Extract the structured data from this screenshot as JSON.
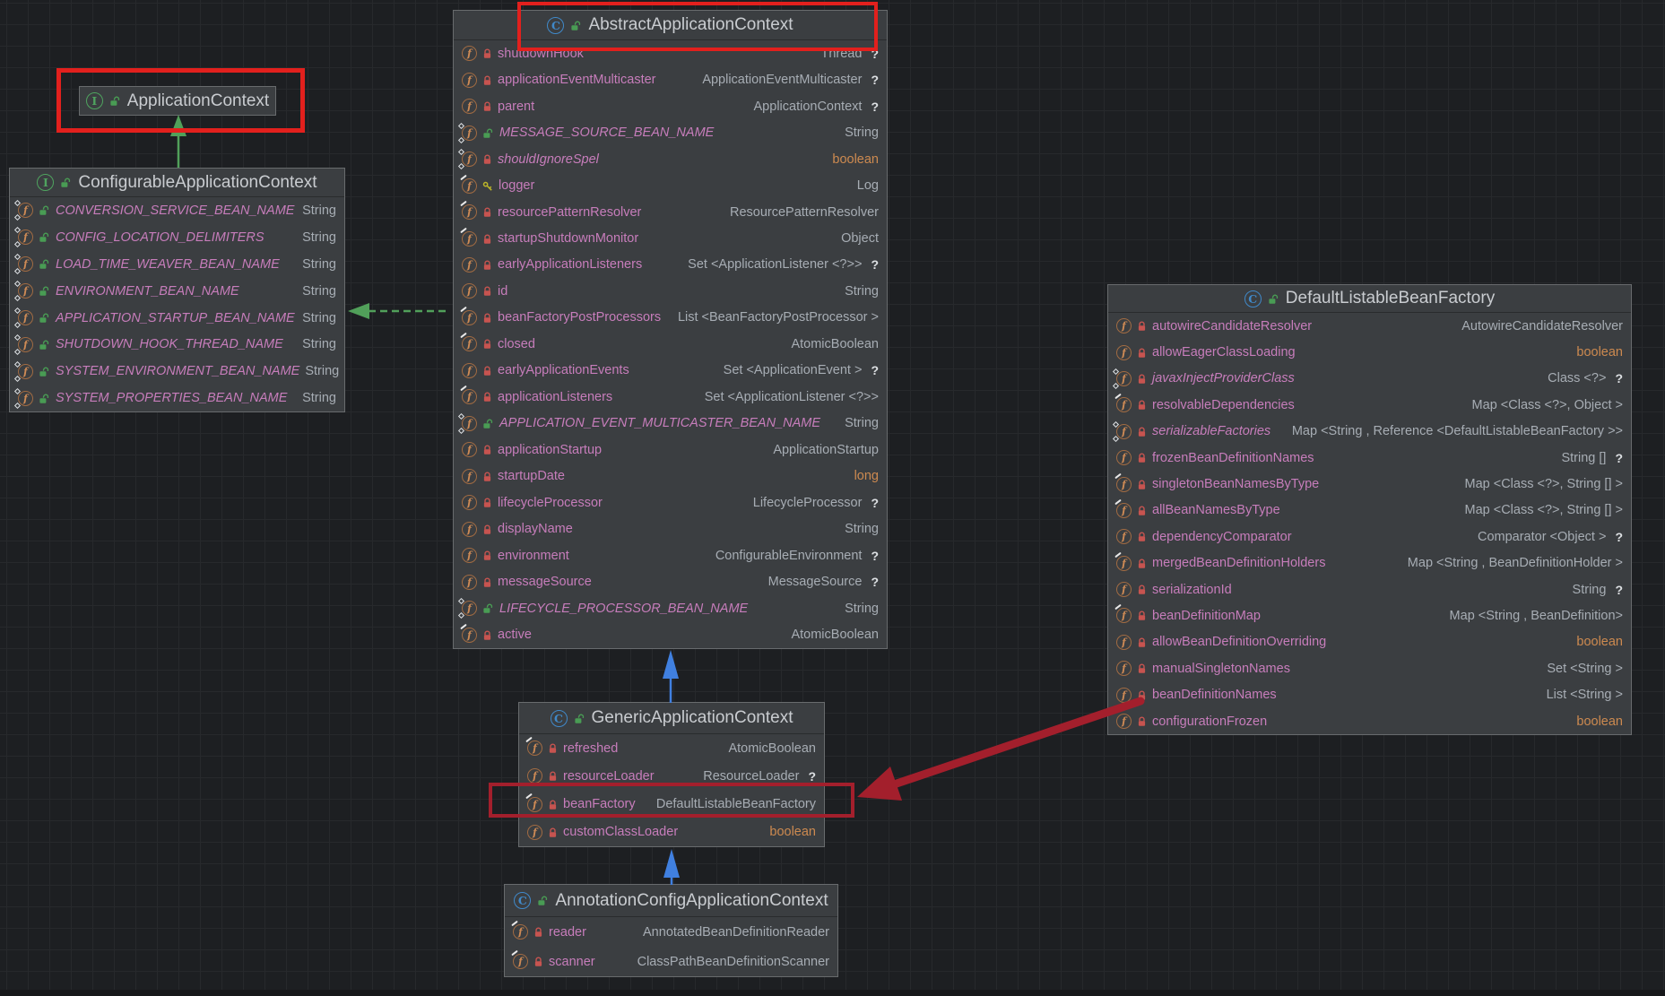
{
  "palette": {
    "canvas_bg": "#1d1f22",
    "grid_line": "#27292c",
    "node_bg": "#3b3e41",
    "node_border": "#686b6d",
    "title_text": "#c9ccd0",
    "field_name": "#c77dbb",
    "type_text": "#a7adb4",
    "primitive_type": "#cd8a50",
    "class_icon_blue": "#4089c9",
    "interface_icon_green": "#4fa45f",
    "field_icon_orange": "#a16b42",
    "private_lock_red": "#c75450",
    "public_lock_green": "#499c54",
    "protected_key_yellow": "#bbb529",
    "arrow_green": "#51a05a",
    "arrow_blue": "#4080e0",
    "annotation_red": "#e2201d",
    "annotation_crimson": "#a31f2c"
  },
  "classes": [
    {
      "id": "applicationContext",
      "kind": "interface",
      "title": "ApplicationContext",
      "fields": []
    },
    {
      "id": "configurableApplicationContext",
      "kind": "interface",
      "title": "ConfigurableApplicationContext",
      "fields": [
        {
          "name": "CONVERSION_SERVICE_BEAN_NAME",
          "vis": "public",
          "mod": "static",
          "type": "String",
          "opt": false,
          "prim": false
        },
        {
          "name": "CONFIG_LOCATION_DELIMITERS",
          "vis": "public",
          "mod": "static",
          "type": "String",
          "opt": false,
          "prim": false
        },
        {
          "name": "LOAD_TIME_WEAVER_BEAN_NAME",
          "vis": "public",
          "mod": "static",
          "type": "String",
          "opt": false,
          "prim": false
        },
        {
          "name": "ENVIRONMENT_BEAN_NAME",
          "vis": "public",
          "mod": "static",
          "type": "String",
          "opt": false,
          "prim": false
        },
        {
          "name": "APPLICATION_STARTUP_BEAN_NAME",
          "vis": "public",
          "mod": "static",
          "type": "String",
          "opt": false,
          "prim": false
        },
        {
          "name": "SHUTDOWN_HOOK_THREAD_NAME",
          "vis": "public",
          "mod": "static",
          "type": "String",
          "opt": false,
          "prim": false
        },
        {
          "name": "SYSTEM_ENVIRONMENT_BEAN_NAME",
          "vis": "public",
          "mod": "static",
          "type": "String",
          "opt": false,
          "prim": false
        },
        {
          "name": "SYSTEM_PROPERTIES_BEAN_NAME",
          "vis": "public",
          "mod": "static",
          "type": "String",
          "opt": false,
          "prim": false
        }
      ]
    },
    {
      "id": "abstractApplicationContext",
      "kind": "class",
      "title": "AbstractApplicationContext",
      "fields": [
        {
          "name": "shutdownHook",
          "vis": "private",
          "mod": "",
          "type": "Thread",
          "opt": true,
          "prim": false
        },
        {
          "name": "applicationEventMulticaster",
          "vis": "private",
          "mod": "",
          "type": "ApplicationEventMulticaster",
          "opt": true,
          "prim": false
        },
        {
          "name": "parent",
          "vis": "private",
          "mod": "",
          "type": "ApplicationContext",
          "opt": true,
          "prim": false
        },
        {
          "name": "MESSAGE_SOURCE_BEAN_NAME",
          "vis": "public",
          "mod": "static",
          "type": "String",
          "opt": false,
          "prim": false
        },
        {
          "name": "shouldIgnoreSpel",
          "vis": "private",
          "mod": "static",
          "type": "boolean",
          "opt": false,
          "prim": true
        },
        {
          "name": "logger",
          "vis": "protected",
          "mod": "final",
          "type": "Log",
          "opt": false,
          "prim": false
        },
        {
          "name": "resourcePatternResolver",
          "vis": "private",
          "mod": "final",
          "type": "ResourcePatternResolver",
          "opt": false,
          "prim": false
        },
        {
          "name": "startupShutdownMonitor",
          "vis": "private",
          "mod": "final",
          "type": "Object",
          "opt": false,
          "prim": false
        },
        {
          "name": "earlyApplicationListeners",
          "vis": "private",
          "mod": "",
          "type": "Set <ApplicationListener <?>>",
          "opt": true,
          "prim": false
        },
        {
          "name": "id",
          "vis": "private",
          "mod": "",
          "type": "String",
          "opt": false,
          "prim": false
        },
        {
          "name": "beanFactoryPostProcessors",
          "vis": "private",
          "mod": "final",
          "type": "List <BeanFactoryPostProcessor >",
          "opt": false,
          "prim": false
        },
        {
          "name": "closed",
          "vis": "private",
          "mod": "final",
          "type": "AtomicBoolean",
          "opt": false,
          "prim": false
        },
        {
          "name": "earlyApplicationEvents",
          "vis": "private",
          "mod": "",
          "type": "Set <ApplicationEvent >",
          "opt": true,
          "prim": false
        },
        {
          "name": "applicationListeners",
          "vis": "private",
          "mod": "final",
          "type": "Set <ApplicationListener <?>>",
          "opt": false,
          "prim": false
        },
        {
          "name": "APPLICATION_EVENT_MULTICASTER_BEAN_NAME",
          "vis": "public",
          "mod": "static",
          "type": "String",
          "opt": false,
          "prim": false
        },
        {
          "name": "applicationStartup",
          "vis": "private",
          "mod": "",
          "type": "ApplicationStartup",
          "opt": false,
          "prim": false
        },
        {
          "name": "startupDate",
          "vis": "private",
          "mod": "",
          "type": "long",
          "opt": false,
          "prim": true
        },
        {
          "name": "lifecycleProcessor",
          "vis": "private",
          "mod": "",
          "type": "LifecycleProcessor",
          "opt": true,
          "prim": false
        },
        {
          "name": "displayName",
          "vis": "private",
          "mod": "",
          "type": "String",
          "opt": false,
          "prim": false
        },
        {
          "name": "environment",
          "vis": "private",
          "mod": "",
          "type": "ConfigurableEnvironment",
          "opt": true,
          "prim": false
        },
        {
          "name": "messageSource",
          "vis": "private",
          "mod": "",
          "type": "MessageSource",
          "opt": true,
          "prim": false
        },
        {
          "name": "LIFECYCLE_PROCESSOR_BEAN_NAME",
          "vis": "public",
          "mod": "static",
          "type": "String",
          "opt": false,
          "prim": false
        },
        {
          "name": "active",
          "vis": "private",
          "mod": "final",
          "type": "AtomicBoolean",
          "opt": false,
          "prim": false
        }
      ]
    },
    {
      "id": "genericApplicationContext",
      "kind": "class",
      "title": "GenericApplicationContext",
      "fields": [
        {
          "name": "refreshed",
          "vis": "private",
          "mod": "final",
          "type": "AtomicBoolean",
          "opt": false,
          "prim": false
        },
        {
          "name": "resourceLoader",
          "vis": "private",
          "mod": "",
          "type": "ResourceLoader",
          "opt": true,
          "prim": false
        },
        {
          "name": "beanFactory",
          "vis": "private",
          "mod": "final",
          "type": "DefaultListableBeanFactory",
          "opt": false,
          "prim": false
        },
        {
          "name": "customClassLoader",
          "vis": "private",
          "mod": "",
          "type": "boolean",
          "opt": false,
          "prim": true
        }
      ]
    },
    {
      "id": "annotationConfigApplicationContext",
      "kind": "class",
      "title": "AnnotationConfigApplicationContext",
      "fields": [
        {
          "name": "reader",
          "vis": "private",
          "mod": "final",
          "type": "AnnotatedBeanDefinitionReader",
          "opt": false,
          "prim": false
        },
        {
          "name": "scanner",
          "vis": "private",
          "mod": "final",
          "type": "ClassPathBeanDefinitionScanner",
          "opt": false,
          "prim": false
        }
      ]
    },
    {
      "id": "defaultListableBeanFactory",
      "kind": "class",
      "title": "DefaultListableBeanFactory",
      "fields": [
        {
          "name": "autowireCandidateResolver",
          "vis": "private",
          "mod": "",
          "type": "AutowireCandidateResolver",
          "opt": false,
          "prim": false
        },
        {
          "name": "allowEagerClassLoading",
          "vis": "private",
          "mod": "",
          "type": "boolean",
          "opt": false,
          "prim": true
        },
        {
          "name": "javaxInjectProviderClass",
          "vis": "private",
          "mod": "static",
          "type": "Class <?>",
          "opt": true,
          "prim": false
        },
        {
          "name": "resolvableDependencies",
          "vis": "private",
          "mod": "final",
          "type": "Map <Class <?>, Object >",
          "opt": false,
          "prim": false
        },
        {
          "name": "serializableFactories",
          "vis": "private",
          "mod": "static",
          "type": "Map <String , Reference <DefaultListableBeanFactory >>",
          "opt": false,
          "prim": false
        },
        {
          "name": "frozenBeanDefinitionNames",
          "vis": "private",
          "mod": "",
          "type": "String []",
          "opt": true,
          "prim": false
        },
        {
          "name": "singletonBeanNamesByType",
          "vis": "private",
          "mod": "final",
          "type": "Map <Class <?>, String [] >",
          "opt": false,
          "prim": false
        },
        {
          "name": "allBeanNamesByType",
          "vis": "private",
          "mod": "final",
          "type": "Map <Class <?>, String [] >",
          "opt": false,
          "prim": false
        },
        {
          "name": "dependencyComparator",
          "vis": "private",
          "mod": "",
          "type": "Comparator <Object >",
          "opt": true,
          "prim": false
        },
        {
          "name": "mergedBeanDefinitionHolders",
          "vis": "private",
          "mod": "final",
          "type": "Map <String , BeanDefinitionHolder >",
          "opt": false,
          "prim": false
        },
        {
          "name": "serializationId",
          "vis": "private",
          "mod": "",
          "type": "String",
          "opt": true,
          "prim": false
        },
        {
          "name": "beanDefinitionMap",
          "vis": "private",
          "mod": "final",
          "type": "Map <String , BeanDefinition>",
          "opt": false,
          "prim": false
        },
        {
          "name": "allowBeanDefinitionOverriding",
          "vis": "private",
          "mod": "",
          "type": "boolean",
          "opt": false,
          "prim": true
        },
        {
          "name": "manualSingletonNames",
          "vis": "private",
          "mod": "",
          "type": "Set <String >",
          "opt": false,
          "prim": false
        },
        {
          "name": "beanDefinitionNames",
          "vis": "private",
          "mod": "",
          "type": "List <String >",
          "opt": false,
          "prim": false
        },
        {
          "name": "configurationFrozen",
          "vis": "private",
          "mod": "",
          "type": "boolean",
          "opt": false,
          "prim": true
        }
      ]
    }
  ],
  "relations": [
    {
      "from": "ConfigurableApplicationContext",
      "to": "ApplicationContext",
      "kind": "extends",
      "line": "solid",
      "color": "green"
    },
    {
      "from": "AbstractApplicationContext",
      "to": "ConfigurableApplicationContext",
      "kind": "implements",
      "line": "dashed",
      "color": "green"
    },
    {
      "from": "GenericApplicationContext",
      "to": "AbstractApplicationContext",
      "kind": "extends",
      "line": "solid",
      "color": "blue"
    },
    {
      "from": "AnnotationConfigApplicationContext",
      "to": "GenericApplicationContext",
      "kind": "extends",
      "line": "solid",
      "color": "blue"
    }
  ],
  "annotations": [
    {
      "kind": "highlight-box",
      "target": "AbstractApplicationContext header"
    },
    {
      "kind": "highlight-box",
      "target": "ApplicationContext node"
    },
    {
      "kind": "highlight-box",
      "target": "GenericApplicationContext beanFactory row"
    },
    {
      "kind": "arrow",
      "from": "DefaultListableBeanFactory",
      "to": "GenericApplicationContext beanFactory row"
    }
  ]
}
